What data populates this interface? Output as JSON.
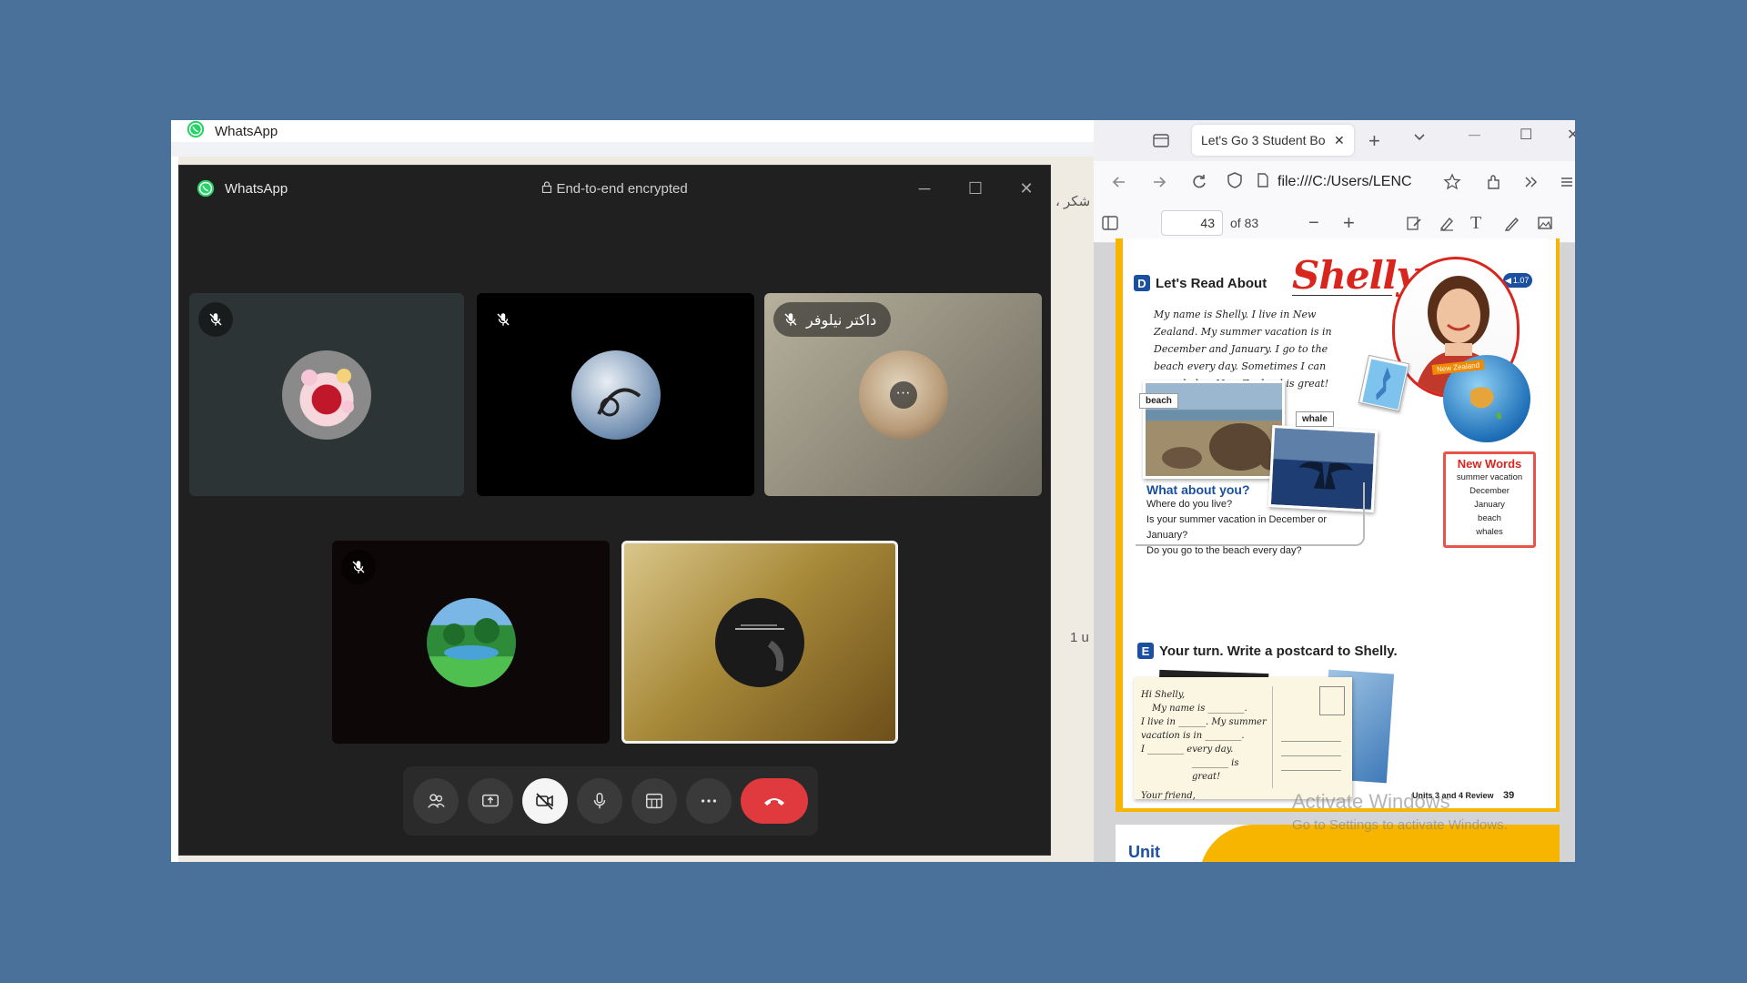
{
  "whatsapp_bg": {
    "title": "WhatsApp",
    "peek_text_1": "، شکر",
    "peek_text_2": "1 u"
  },
  "call": {
    "title": "WhatsApp",
    "encryption_label": "End-to-end encrypted",
    "participants": [
      {
        "muted": true,
        "name": ""
      },
      {
        "muted": true,
        "name": ""
      },
      {
        "muted": true,
        "name": "داکتر نیلوفر"
      },
      {
        "muted": true,
        "name": ""
      },
      {
        "muted": false,
        "name": "",
        "active_speaker": true
      }
    ],
    "controls": [
      "participants",
      "share-screen",
      "camera-off",
      "microphone",
      "layout",
      "more",
      "end-call"
    ]
  },
  "browser": {
    "tab_title": "Let's Go 3 Student Bo",
    "url": "file:///C:/Users/LENC",
    "page_number": "43",
    "page_count": "of 83"
  },
  "pdf": {
    "section_d_letter": "D",
    "section_d_title": "Let's Read About",
    "shelly_title": "Shelly",
    "audio_badge": "1.07",
    "reading_text": "My name is Shelly. I live in New Zealand. My summer vacation is in December and January. I go to the beach every day. Sometimes I can see whales. New Zealand is great!",
    "label_beach": "beach",
    "label_whale": "whale",
    "label_nz": "New Zealand",
    "what_about_title": "What about you?",
    "questions": [
      "Where do you live?",
      "Is your summer vacation in December or January?",
      "Do you go to the beach every day?"
    ],
    "new_words_title": "New Words",
    "new_words": [
      "summer vacation",
      "December",
      "January",
      "beach",
      "whales"
    ],
    "section_e_letter": "E",
    "section_e_title": "Your turn. Write a postcard to Shelly.",
    "postcard_lines": [
      "Hi Shelly,",
      "My name is ________.",
      "I live in ______. My summer",
      "vacation is in ________.",
      "I ________ every day.",
      "________ is great!",
      "Your friend,"
    ],
    "footer_text": "Units 3 and 4 Review",
    "footer_page": "39",
    "next_page_text": "Unit"
  },
  "watermark": {
    "line1": "Activate Windows",
    "line2": "Go to Settings to activate Windows."
  },
  "colors": {
    "desktop": "#4a719a",
    "whatsapp_green": "#25d366",
    "end_call": "#e0393e",
    "pdf_yellow": "#f7b500",
    "pdf_red": "#d8261f",
    "pdf_blue": "#1b4fa0"
  }
}
